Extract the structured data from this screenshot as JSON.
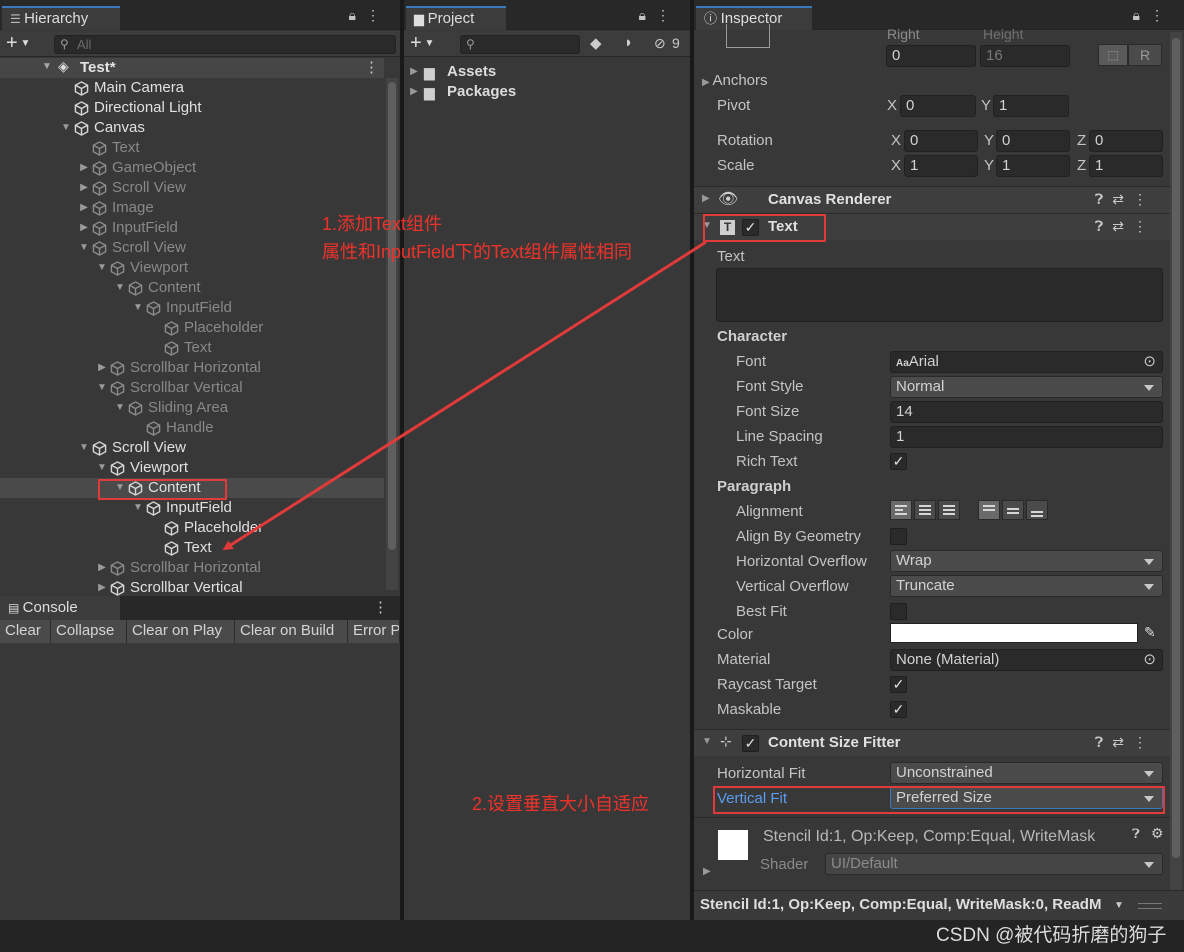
{
  "hierarchy": {
    "tab_label": "Hierarchy",
    "search_placeholder": "All",
    "scene": "Test*",
    "rows": [
      {
        "label": "Main Camera",
        "indent": 1,
        "arrow": "",
        "dim": false
      },
      {
        "label": "Directional Light",
        "indent": 1,
        "arrow": "",
        "dim": false
      },
      {
        "label": "Canvas",
        "indent": 1,
        "arrow": "down",
        "dim": false
      },
      {
        "label": "Text",
        "indent": 2,
        "arrow": "",
        "dim": true
      },
      {
        "label": "GameObject",
        "indent": 2,
        "arrow": "right",
        "dim": true
      },
      {
        "label": "Scroll View",
        "indent": 2,
        "arrow": "right",
        "dim": true
      },
      {
        "label": "Image",
        "indent": 2,
        "arrow": "right",
        "dim": true
      },
      {
        "label": "InputField",
        "indent": 2,
        "arrow": "right",
        "dim": true
      },
      {
        "label": "Scroll View",
        "indent": 2,
        "arrow": "down",
        "dim": true
      },
      {
        "label": "Viewport",
        "indent": 3,
        "arrow": "down",
        "dim": true
      },
      {
        "label": "Content",
        "indent": 4,
        "arrow": "down",
        "dim": true
      },
      {
        "label": "InputField",
        "indent": 5,
        "arrow": "down",
        "dim": true
      },
      {
        "label": "Placeholder",
        "indent": 6,
        "arrow": "",
        "dim": true
      },
      {
        "label": "Text",
        "indent": 6,
        "arrow": "",
        "dim": true
      },
      {
        "label": "Scrollbar Horizontal",
        "indent": 3,
        "arrow": "right",
        "dim": true
      },
      {
        "label": "Scrollbar Vertical",
        "indent": 3,
        "arrow": "down",
        "dim": true
      },
      {
        "label": "Sliding Area",
        "indent": 4,
        "arrow": "down",
        "dim": true
      },
      {
        "label": "Handle",
        "indent": 5,
        "arrow": "",
        "dim": true
      },
      {
        "label": "Scroll View",
        "indent": 2,
        "arrow": "down",
        "dim": false
      },
      {
        "label": "Viewport",
        "indent": 3,
        "arrow": "down",
        "dim": false
      },
      {
        "label": "Content",
        "indent": 4,
        "arrow": "down",
        "dim": false,
        "selected": true
      },
      {
        "label": "InputField",
        "indent": 5,
        "arrow": "down",
        "dim": false
      },
      {
        "label": "Placeholder",
        "indent": 6,
        "arrow": "",
        "dim": false
      },
      {
        "label": "Text",
        "indent": 6,
        "arrow": "",
        "dim": false
      },
      {
        "label": "Scrollbar Horizontal",
        "indent": 3,
        "arrow": "right",
        "dim": true
      },
      {
        "label": "Scrollbar Vertical",
        "indent": 3,
        "arrow": "right",
        "dim": false
      }
    ]
  },
  "console": {
    "tab_label": "Console",
    "buttons": [
      "Clear",
      "Collapse",
      "Clear on Play",
      "Clear on Build",
      "Error P"
    ]
  },
  "project": {
    "tab_label": "Project",
    "hidden_count": "9",
    "folders": [
      "Assets",
      "Packages"
    ]
  },
  "inspector": {
    "tab_label": "Inspector",
    "rect": {
      "right_label": "Right",
      "height_label": "Height",
      "right": "0",
      "height": "16",
      "r_button": "R"
    },
    "anchors_label": "Anchors",
    "pivot": {
      "label": "Pivot",
      "x": "0",
      "y": "1"
    },
    "rotation": {
      "label": "Rotation",
      "x": "0",
      "y": "0",
      "z": "0"
    },
    "scale": {
      "label": "Scale",
      "x": "1",
      "y": "1",
      "z": "1"
    },
    "axis": {
      "x": "X",
      "y": "Y",
      "z": "Z"
    },
    "canvas_renderer": "Canvas Renderer",
    "text_component": {
      "title": "Text",
      "text_label": "Text",
      "text_value": "",
      "character_header": "Character",
      "font_label": "Font",
      "font_value": "Arial",
      "font_style_label": "Font Style",
      "font_style_value": "Normal",
      "font_size_label": "Font Size",
      "font_size_value": "14",
      "line_spacing_label": "Line Spacing",
      "line_spacing_value": "1",
      "rich_text_label": "Rich Text",
      "rich_text": true,
      "paragraph_header": "Paragraph",
      "alignment_label": "Alignment",
      "align_by_geometry_label": "Align By Geometry",
      "align_by_geometry": false,
      "horizontal_overflow_label": "Horizontal Overflow",
      "horizontal_overflow_value": "Wrap",
      "vertical_overflow_label": "Vertical Overflow",
      "vertical_overflow_value": "Truncate",
      "best_fit_label": "Best Fit",
      "best_fit": false,
      "color_label": "Color",
      "color_value": "#ffffff",
      "material_label": "Material",
      "material_value": "None (Material)",
      "raycast_label": "Raycast Target",
      "raycast": true,
      "maskable_label": "Maskable",
      "maskable": true
    },
    "content_size_fitter": {
      "title": "Content Size Fitter",
      "horizontal_fit_label": "Horizontal Fit",
      "horizontal_fit_value": "Unconstrained",
      "vertical_fit_label": "Vertical Fit",
      "vertical_fit_value": "Preferred Size"
    },
    "material_preview": {
      "name": "Stencil Id:1, Op:Keep, Comp:Equal, WriteMask",
      "shader_label": "Shader",
      "shader_value": "UI/Default"
    },
    "bottom_dropdown": "Stencil Id:1, Op:Keep, Comp:Equal, WriteMask:0, ReadM"
  },
  "annotations": {
    "note1_line1": "1.添加Text组件",
    "note1_line2": "属性和InputField下的Text组件属性相同",
    "note2": "2.设置垂直大小自适应"
  },
  "watermark": "CSDN @被代码折磨的狗子",
  "colors": {
    "annotation": "#e03a3a",
    "accent_tab": "#3a79bb",
    "link_label": "#5b9bf0"
  }
}
